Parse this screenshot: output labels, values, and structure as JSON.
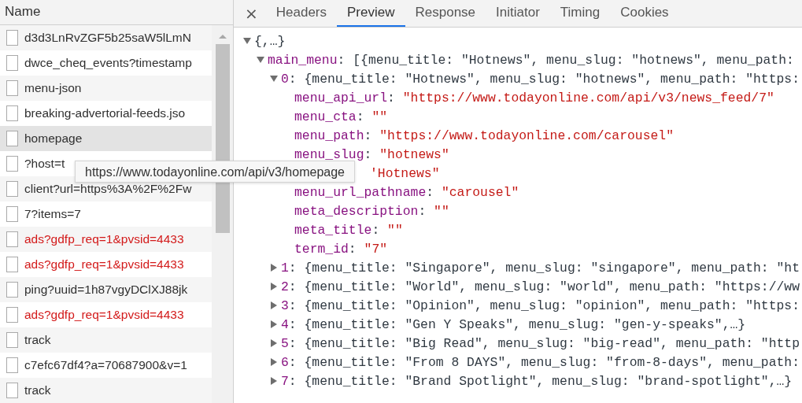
{
  "requests": {
    "header": "Name",
    "rows": [
      {
        "name": "d3d3LnRvZGF5b25saW5lLmN",
        "error": false,
        "selected": false
      },
      {
        "name": "dwce_cheq_events?timestamp",
        "error": false,
        "selected": false
      },
      {
        "name": "menu-json",
        "error": false,
        "selected": false
      },
      {
        "name": "breaking-advertorial-feeds.jso",
        "error": false,
        "selected": false
      },
      {
        "name": "homepage",
        "error": false,
        "selected": true
      },
      {
        "name": "?host=t",
        "error": false,
        "selected": false
      },
      {
        "name": "client?url=https%3A%2F%2Fw",
        "error": false,
        "selected": false
      },
      {
        "name": "7?items=7",
        "error": false,
        "selected": false
      },
      {
        "name": "ads?gdfp_req=1&pvsid=4433",
        "error": true,
        "selected": false
      },
      {
        "name": "ads?gdfp_req=1&pvsid=4433",
        "error": true,
        "selected": false
      },
      {
        "name": "ping?uuid=1h87vgyDClXJ88jk",
        "error": false,
        "selected": false
      },
      {
        "name": "ads?gdfp_req=1&pvsid=4433",
        "error": true,
        "selected": false
      },
      {
        "name": "track",
        "error": false,
        "selected": false
      },
      {
        "name": "c7efc67df4?a=70687900&v=1",
        "error": false,
        "selected": false
      },
      {
        "name": "track",
        "error": false,
        "selected": false
      }
    ],
    "tooltip": "https://www.todayonline.com/api/v3/homepage"
  },
  "details": {
    "close": "×",
    "tabs": [
      {
        "label": "Headers",
        "selected": false
      },
      {
        "label": "Preview",
        "selected": true
      },
      {
        "label": "Response",
        "selected": false
      },
      {
        "label": "Initiator",
        "selected": false
      },
      {
        "label": "Timing",
        "selected": false
      },
      {
        "label": "Cookies",
        "selected": false
      }
    ]
  },
  "preview": {
    "summary": "{,…}",
    "expanded": true,
    "children": [
      {
        "key": "main_menu",
        "summary": ": [{menu_title: \"Hotnews\", menu_slug: \"hotnews\", menu_path:",
        "expanded": true,
        "children": [
          {
            "key": "0",
            "summary": ": {menu_title: \"Hotnews\", menu_slug: \"hotnews\", menu_path: \"https:",
            "expanded": true,
            "children": [
              {
                "key": "menu_api_url",
                "value": ": \"https://www.todayonline.com/api/v3/news_feed/7\""
              },
              {
                "key": "menu_cta",
                "value": ": \"\""
              },
              {
                "key": "menu_path",
                "value": ": \"https://www.todayonline.com/carousel\""
              },
              {
                "key": "menu_slug",
                "value": ": \"hotnews\""
              },
              {
                "value": "'Hotnews\""
              },
              {
                "key": "menu_url_pathname",
                "value": ": \"carousel\""
              },
              {
                "key": "meta_description",
                "value": ": \"\""
              },
              {
                "key": "meta_title",
                "value": ": \"\""
              },
              {
                "key": "term_id",
                "value": ": \"7\""
              }
            ]
          },
          {
            "key": "1",
            "summary": ": {menu_title: \"Singapore\", menu_slug: \"singapore\", menu_path: \"ht",
            "expanded": false
          },
          {
            "key": "2",
            "summary": ": {menu_title: \"World\", menu_slug: \"world\", menu_path: \"https://ww",
            "expanded": false
          },
          {
            "key": "3",
            "summary": ": {menu_title: \"Opinion\", menu_slug: \"opinion\", menu_path: \"https:",
            "expanded": false
          },
          {
            "key": "4",
            "summary": ": {menu_title: \"Gen Y Speaks\", menu_slug: \"gen-y-speaks\",…}",
            "expanded": false
          },
          {
            "key": "5",
            "summary": ": {menu_title: \"Big Read\", menu_slug: \"big-read\", menu_path: \"http",
            "expanded": false
          },
          {
            "key": "6",
            "summary": ": {menu_title: \"From 8 DAYS\", menu_slug: \"from-8-days\", menu_path:",
            "expanded": false
          },
          {
            "key": "7",
            "summary": ": {menu_title: \"Brand Spotlight\", menu_slug: \"brand-spotlight\",…}",
            "expanded": false
          }
        ]
      }
    ]
  }
}
